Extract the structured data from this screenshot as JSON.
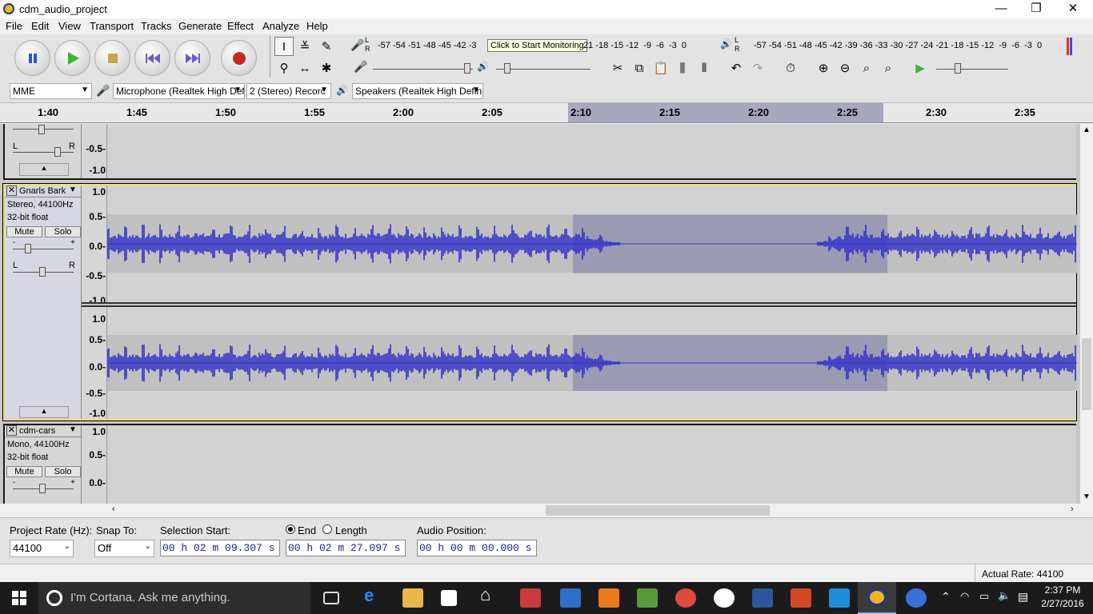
{
  "window": {
    "title": "cdm_audio_project",
    "controls": [
      "—",
      "❐",
      "✕"
    ]
  },
  "menu": [
    "File",
    "Edit",
    "View",
    "Transport",
    "Tracks",
    "Generate",
    "Effect",
    "Analyze",
    "Help"
  ],
  "meter": {
    "rec_scale": "-57 -54 -51 -48 -45 -42 -3",
    "tooltip": "Click to Start Monitoring",
    "rec_scale_tail": "21 -18 -15 -12  -9  -6  -3  0",
    "play_scale": "-57 -54 -51 -48 -45 -42 -39 -36 -33 -30 -27 -24 -21 -18 -15 -12  -9  -6  -3  0",
    "lr": "L\nR"
  },
  "device": {
    "host": "MME",
    "mic": "Microphone (Realtek High Def",
    "channels": "2 (Stereo) Recorc",
    "speakers": "Speakers (Realtek High Defini"
  },
  "ruler": {
    "ticks": [
      "1:40",
      "1:45",
      "1:50",
      "1:55",
      "2:00",
      "2:05",
      "2:10",
      "2:15",
      "2:20",
      "2:25",
      "2:30",
      "2:35"
    ]
  },
  "tracks": [
    {
      "name": "Gnarls Bark",
      "format": "Stereo, 44100Hz",
      "bitdepth": "32-bit float",
      "mute": "Mute",
      "solo": "Solo",
      "scale": [
        "1.0",
        "0.5-",
        "0.0-",
        "-0.5-",
        "-1.0"
      ]
    },
    {
      "name": "cdm-cars",
      "format": "Mono, 44100Hz",
      "bitdepth": "32-bit float",
      "mute": "Mute",
      "solo": "Solo",
      "scale": [
        "1.0",
        "0.5-",
        "0.0-"
      ]
    }
  ],
  "top_partial_scale": [
    "-0.5-",
    "-1.0"
  ],
  "selection": {
    "rate_label": "Project Rate (Hz):",
    "rate_value": "44100",
    "snap_label": "Snap To:",
    "snap_value": "Off",
    "start_label": "Selection Start:",
    "start_value": "00 h 02 m 09.307 s",
    "end_label": "End",
    "length_label": "Length",
    "end_value": "00 h 02 m 27.097 s",
    "audio_pos_label": "Audio Position:",
    "audio_pos_value": "00 h 00 m 00.000 s"
  },
  "status": {
    "actual_rate": "Actual Rate: 44100"
  },
  "taskbar": {
    "cortana": "I'm Cortana. Ask me anything.",
    "time": "2:37 PM",
    "date": "2/27/2016"
  },
  "colors": {
    "wave": "#3232c8",
    "selection": "#9a9ab2",
    "track_selected_border": "#e7e070"
  }
}
